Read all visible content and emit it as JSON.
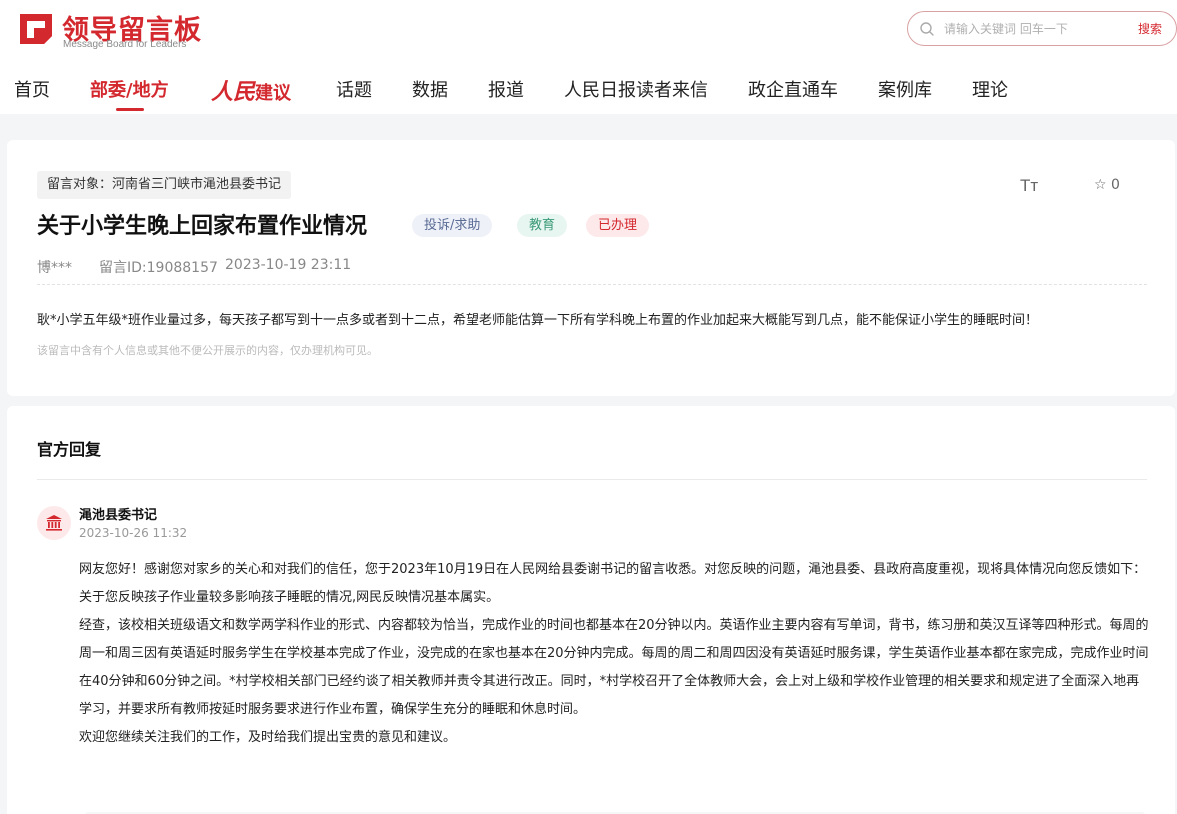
{
  "header": {
    "logo_title": "领导留言板",
    "logo_subtitle": "Message Board for Leaders",
    "search": {
      "placeholder": "请输入关键词 回车一下",
      "button": "搜索"
    },
    "brand_color": "#d4282f"
  },
  "nav": {
    "items": [
      {
        "label": "首页",
        "active": false
      },
      {
        "label": "部委/地方",
        "active": true
      },
      {
        "label_a": "人民",
        "label_b": "建议",
        "active": false
      },
      {
        "label": "话题",
        "active": false
      },
      {
        "label": "数据",
        "active": false
      },
      {
        "label": "报道",
        "active": false
      },
      {
        "label": "人民日报读者来信",
        "active": false
      },
      {
        "label": "政企直通车",
        "active": false
      },
      {
        "label": "案例库",
        "active": false
      },
      {
        "label": "理论",
        "active": false
      }
    ]
  },
  "message": {
    "target": "留言对象：河南省三门峡市渑池县委书记",
    "font_tool": "Tт",
    "favorite_count": "☆ 0",
    "title": "关于小学生晚上回家布置作业情况",
    "badges": {
      "type": "投诉/求助",
      "category": "教育",
      "status": "已办理"
    },
    "author": "博***",
    "id": "留言ID:19088157",
    "date": "2023-10-19 23:11",
    "content": "耿*小学五年级*班作业量过多，每天孩子都写到十一点多或者到十二点，希望老师能估算一下所有学科晚上布置的作业加起来大概能写到几点，能不能保证小学生的睡眠时间！",
    "notice": "该留言中含有个人信息或其他不便公开展示的内容，仅办理机构可见。"
  },
  "reply": {
    "heading": "官方回复",
    "replier": "渑池县委书记",
    "time": "2023-10-26 11:32",
    "paragraphs": [
      "网友您好！感谢您对家乡的关心和对我们的信任，您于2023年10月19日在人民网给县委谢书记的留言收悉。对您反映的问题，渑池县委、县政府高度重视，现将具体情况向您反馈如下：",
      "关于您反映孩子作业量较多影响孩子睡眠的情况,网民反映情况基本属实。",
      "经查，该校相关班级语文和数学两学科作业的形式、内容都较为恰当，完成作业的时间也都基本在20分钟以内。英语作业主要内容有写单词，背书，练习册和英汉互译等四种形式。每周的周一和周三因有英语延时服务学生在学校基本完成了作业，没完成的在家也基本在20分钟内完成。每周的周二和周四因没有英语延时服务课，学生英语作业基本都在家完成，完成作业时间在40分钟和60分钟之间。*村学校相关部门已经约谈了相关教师并责令其进行改正。同时，*村学校召开了全体教师大会，会上对上级和学校作业管理的相关要求和规定进了全面深入地再学习，并要求所有教师按延时服务要求进行作业布置，确保学生充分的睡眠和休息时间。",
      "欢迎您继续关注我们的工作，及时给我们提出宝贵的意见和建议。"
    ]
  }
}
